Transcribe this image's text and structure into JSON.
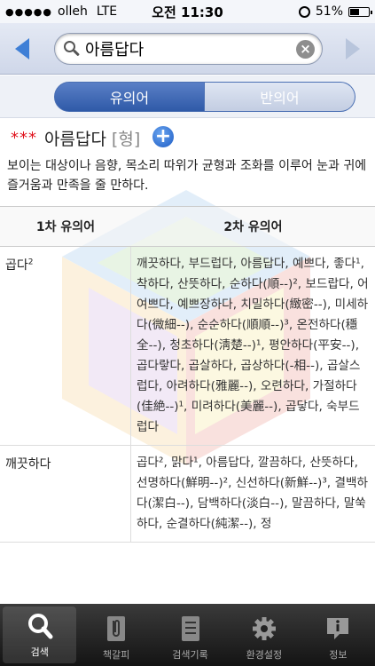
{
  "status": {
    "carrier": "olleh",
    "network": "LTE",
    "time": "오전 11:30",
    "battery_percent": "51%",
    "battery_level": 0.51,
    "signal_dots": "●●●●●"
  },
  "search": {
    "query": "아름답다",
    "clear_icon": "×"
  },
  "segments": {
    "synonym": "유의어",
    "antonym": "반의어",
    "active": "synonym"
  },
  "entry": {
    "stars": "***",
    "word": "아름답다",
    "pos": "[형]",
    "add_icon": "+",
    "definition": "보이는 대상이나 음향, 목소리 따위가 균형과 조화를 이루어 눈과 귀에 즐거움과 만족을 줄 만하다."
  },
  "table": {
    "headers": [
      "1차 유의어",
      "2차 유의어"
    ],
    "rows": [
      {
        "word": "곱다",
        "superscript": "2",
        "synonyms": "깨끗하다, 부드럽다, 아름답다, 예쁘다, 좋다¹, 착하다, 산뜻하다, 순하다(順--)², 보드랍다, 어여쁘다, 예쁘장하다, 치밀하다(緻密--), 미세하다(微細--), 순순하다(順順--)³, 온전하다(穩全--), 청초하다(淸楚--)¹, 평안하다(平安--), 곱다랗다, 곱살하다, 곱상하다(-相--), 곱살스럽다, 아려하다(雅麗--), 오련하다, 가절하다(佳絶--)¹, 미려하다(美麗--), 곱닿다, 숙부드럽다"
      },
      {
        "word": "깨끗하다",
        "superscript": "",
        "synonyms": "곱다², 맑다¹, 아름답다, 깔끔하다, 산뜻하다, 선명하다(鮮明--)², 신선하다(新鮮--)³, 결백하다(潔白--), 담백하다(淡白--), 말끔하다, 말쑥하다, 순결하다(純潔--), 정"
      }
    ]
  },
  "tabs": [
    {
      "label": "검색",
      "icon": "search-icon",
      "active": true
    },
    {
      "label": "책갈피",
      "icon": "paperclip-icon",
      "active": false
    },
    {
      "label": "검색기록",
      "icon": "notebook-icon",
      "active": false
    },
    {
      "label": "환경설정",
      "icon": "gear-icon",
      "active": false
    },
    {
      "label": "정보",
      "icon": "info-bubble-icon",
      "active": false
    }
  ],
  "colors": {
    "accent": "#2f5aa8",
    "stars": "#e0141e",
    "tabbar": "#1e1e1e"
  }
}
